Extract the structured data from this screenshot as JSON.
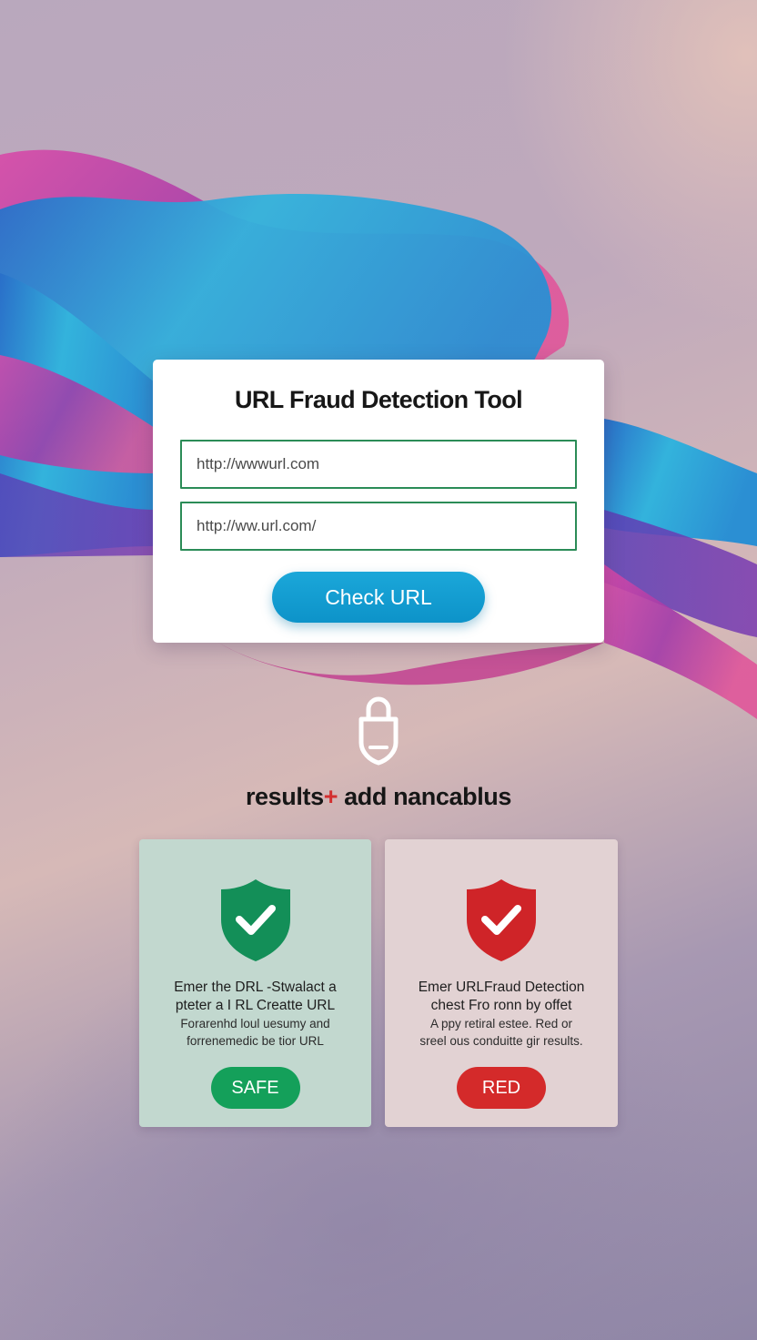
{
  "tool": {
    "title": "URL Fraud Detection Tool",
    "url_input_1": "http://wwwurl.com",
    "url_input_2": "http://ww.url.com/",
    "check_button": "Check URL"
  },
  "results": {
    "heading_a": "results",
    "heading_plus": "+",
    "heading_b": " add nancablus"
  },
  "cards": {
    "safe": {
      "line1": "Emer the DRL -Stwalact a",
      "line2": "pteter a I RL Creatte URL",
      "line3": "Forarenhd loul uesumy and",
      "line4": "forrenemedic be tior URL",
      "badge": "SAFE"
    },
    "red": {
      "line1": "Emer URLFraud Detection",
      "line2": "chest Fro ronn by offet",
      "line3": "A ppy retiral estee. Red or",
      "line4": "sreel ous conduitte gir results.",
      "badge": "RED"
    }
  },
  "colors": {
    "safe": "#14a05a",
    "danger": "#d42a2a",
    "accent": "#1ba7d9",
    "input_border": "#2b8c57"
  },
  "icons": {
    "lock": "lock-icon",
    "safe_shield": "shield-check-icon",
    "danger_shield": "shield-check-icon"
  }
}
